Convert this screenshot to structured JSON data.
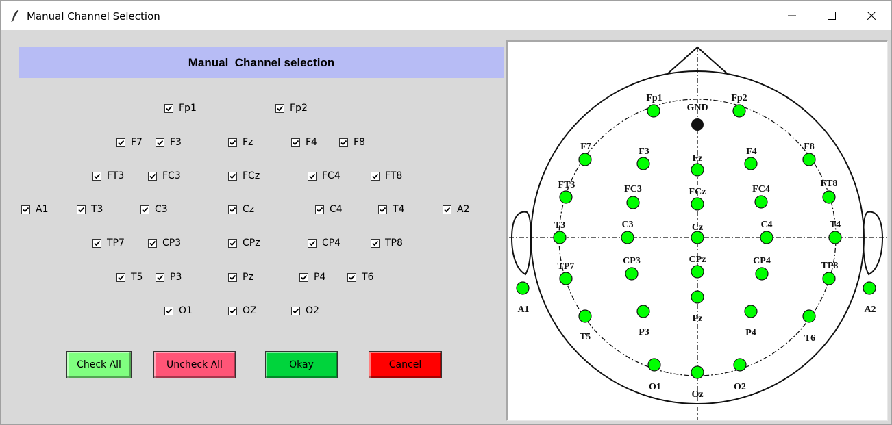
{
  "window": {
    "title": "Manual Channel Selection",
    "controls": [
      "minimize",
      "maximize",
      "close"
    ]
  },
  "header": {
    "title": "Manual  Channel selection"
  },
  "checkboxes": [
    {
      "label": "Fp1",
      "checked": true
    },
    {
      "label": "Fp2",
      "checked": true
    },
    {
      "label": "F7",
      "checked": true
    },
    {
      "label": "F3",
      "checked": true
    },
    {
      "label": "Fz",
      "checked": true
    },
    {
      "label": "F4",
      "checked": true
    },
    {
      "label": "F8",
      "checked": true
    },
    {
      "label": "FT3",
      "checked": true
    },
    {
      "label": "FC3",
      "checked": true
    },
    {
      "label": "FCz",
      "checked": true
    },
    {
      "label": "FC4",
      "checked": true
    },
    {
      "label": "FT8",
      "checked": true
    },
    {
      "label": "A1",
      "checked": true
    },
    {
      "label": "T3",
      "checked": true
    },
    {
      "label": "C3",
      "checked": true
    },
    {
      "label": "Cz",
      "checked": true
    },
    {
      "label": "C4",
      "checked": true
    },
    {
      "label": "T4",
      "checked": true
    },
    {
      "label": "A2",
      "checked": true
    },
    {
      "label": "TP7",
      "checked": true
    },
    {
      "label": "CP3",
      "checked": true
    },
    {
      "label": "CPz",
      "checked": true
    },
    {
      "label": "CP4",
      "checked": true
    },
    {
      "label": "TP8",
      "checked": true
    },
    {
      "label": "T5",
      "checked": true
    },
    {
      "label": "P3",
      "checked": true
    },
    {
      "label": "Pz",
      "checked": true
    },
    {
      "label": "P4",
      "checked": true
    },
    {
      "label": "T6",
      "checked": true
    },
    {
      "label": "O1",
      "checked": true
    },
    {
      "label": "OZ",
      "checked": true
    },
    {
      "label": "O2",
      "checked": true
    }
  ],
  "buttons": {
    "check_all": {
      "label": "Check All",
      "color": "#80ff80"
    },
    "uncheck_all": {
      "label": "Uncheck All",
      "color": "#ff5577"
    },
    "okay": {
      "label": "Okay",
      "color": "#00d43c"
    },
    "cancel": {
      "label": "Cancel",
      "color": "#ff0000"
    }
  },
  "electrode_map": {
    "ground_label": "GND",
    "electrode_color": "#00ff00",
    "ground_color": "#111111",
    "labels": {
      "fp1": "Fp1",
      "fp2": "Fp2",
      "f7": "F7",
      "f3": "F3",
      "fz": "Fz",
      "f4": "F4",
      "f8": "F8",
      "ft3": "FT3",
      "fc3": "FC3",
      "fcz": "FCz",
      "fc4": "FC4",
      "ft8": "FT8",
      "t3": "T3",
      "c3": "C3",
      "cz": "Cz",
      "c4": "C4",
      "t4": "T4",
      "a1": "A1",
      "a2": "A2",
      "tp7": "TP7",
      "cp3": "CP3",
      "cpz": "CPz",
      "cp4": "CP4",
      "tp8": "TP8",
      "t5": "T5",
      "p3": "P3",
      "pz": "Pz",
      "p4": "P4",
      "t6": "T6",
      "o1": "O1",
      "oz": "Oz",
      "o2": "O2"
    }
  }
}
